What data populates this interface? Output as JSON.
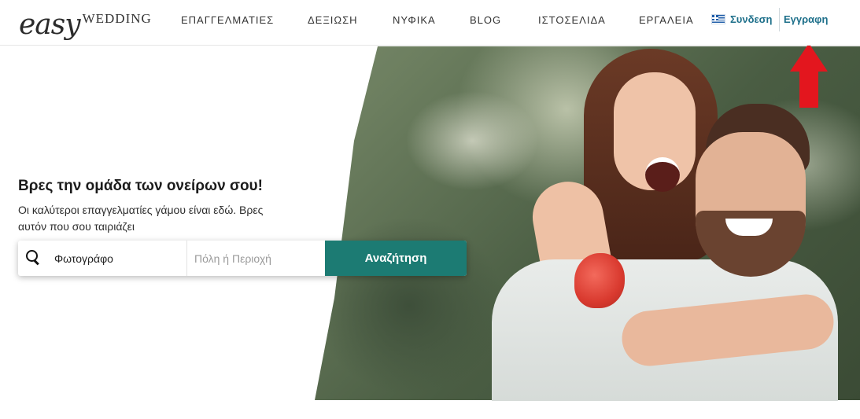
{
  "header": {
    "logo": {
      "script": "easy",
      "word": "WEDDING"
    },
    "nav": [
      "ΕΠΑΓΓΕΛΜΑΤΙΕΣ",
      "ΔΕΞΙΩΣΗ",
      "ΝΥΦΙΚΑ",
      "BLOG",
      "ΙΣΤΟΣΕΛΙΔΑ",
      "ΕΡΓΑΛΕΙΑ"
    ],
    "language_icon": "greek-flag-icon",
    "login_label": "Συνδεση",
    "register_label": "Εγγραφη"
  },
  "hero": {
    "title": "Βρες την ομάδα των ονείρων σου!",
    "subtitle": "Οι καλύτεροι επαγγελματίες γάμου είναι εδώ. Βρες αυτόν που σου ταιριάζει",
    "search": {
      "icon": "search-icon",
      "what_value": "Φωτογράφο",
      "where_placeholder": "Πόλη ή Περιοχή",
      "button_label": "Αναζήτηση"
    }
  },
  "annotation": {
    "icon": "red-arrow-up-icon",
    "color": "#e3161e"
  },
  "colors": {
    "accent": "#1c7b73",
    "link": "#1d6f8a"
  }
}
